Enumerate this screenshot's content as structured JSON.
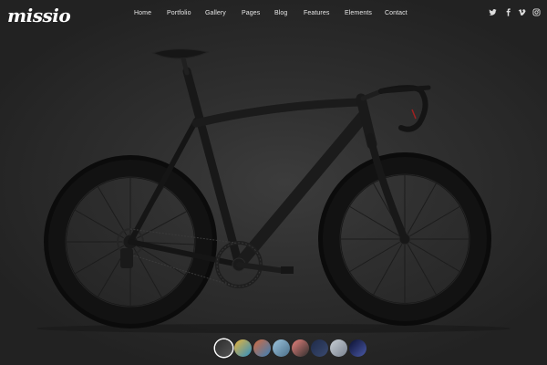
{
  "brand": {
    "logo_text": "missio"
  },
  "nav": {
    "items": [
      {
        "label": "Home"
      },
      {
        "label": "Portfolio"
      },
      {
        "label": "Gallery"
      },
      {
        "label": "Pages"
      },
      {
        "label": "Blog"
      },
      {
        "label": "Features"
      },
      {
        "label": "Elements"
      },
      {
        "label": "Contact"
      }
    ]
  },
  "social": {
    "icons": [
      "twitter-icon",
      "facebook-icon",
      "vimeo-icon",
      "instagram-icon"
    ]
  },
  "hero": {
    "subject": "black road bicycle"
  },
  "gallery": {
    "thumbnails": [
      {
        "name": "bicycle",
        "colors": [
          "#2c2c2c",
          "#555555"
        ],
        "active": true
      },
      {
        "name": "colorful",
        "colors": [
          "#e8b33a",
          "#2d8fc4"
        ]
      },
      {
        "name": "boxes",
        "colors": [
          "#d36a3f",
          "#3a7fb8"
        ]
      },
      {
        "name": "landscape",
        "colors": [
          "#9cc3dc",
          "#4a6f8a"
        ]
      },
      {
        "name": "pink",
        "colors": [
          "#e8827c",
          "#2f2f2f"
        ]
      },
      {
        "name": "navy",
        "colors": [
          "#1e2a48",
          "#3a4a70"
        ]
      },
      {
        "name": "mountain",
        "colors": [
          "#c7cdd4",
          "#7a8390"
        ]
      },
      {
        "name": "galaxy",
        "colors": [
          "#0c1030",
          "#4a5aa8"
        ]
      }
    ]
  }
}
